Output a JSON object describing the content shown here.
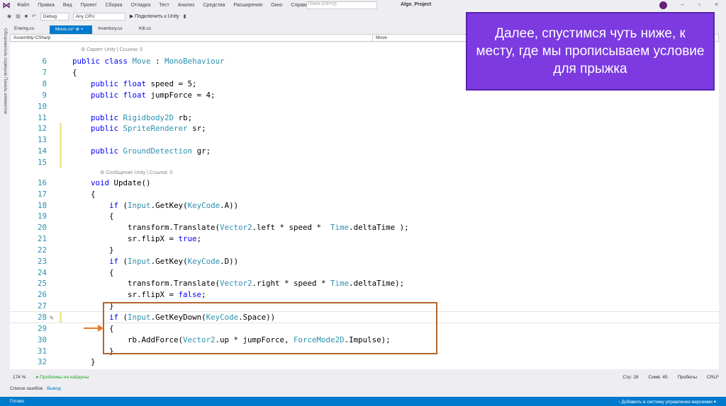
{
  "menu": [
    "Файл",
    "Правка",
    "Вид",
    "Проект",
    "Сборка",
    "Отладка",
    "Тест",
    "Анализ",
    "Средства",
    "Расширения",
    "Окно",
    "Справка"
  ],
  "search_placeholder": "Поиск (Ctrl+Q)",
  "project": "Algo_Project",
  "toolbar": {
    "config": "Debug",
    "platform": "Any CPU",
    "attach": "▶ Подключить к Unity"
  },
  "tabs": [
    {
      "label": "Enemy.cs"
    },
    {
      "label": "Move.cs*  ⊕ ×"
    },
    {
      "label": "Inventory.cs"
    },
    {
      "label": "Kill.cs"
    }
  ],
  "nav": {
    "project": "Assembly-CSharp",
    "class": "Move"
  },
  "side": "Обозреватель серверов   Панель элементов",
  "lens": {
    "class": "⚙ Скрипт Unity | Ссылок: 0",
    "method": "⚙ Сообщение Unity | Ссылок: 0"
  },
  "lines": [
    {
      "n": "6",
      "h": "<span class=kw>public class</span> <span class=ty>Move</span> : <span class=ty>MonoBehaviour</span>"
    },
    {
      "n": "7",
      "h": "{"
    },
    {
      "n": "8",
      "h": "    <span class=kw>public float</span> speed = 5;"
    },
    {
      "n": "9",
      "h": "    <span class=kw>public float</span> jumpForce = 4;"
    },
    {
      "n": "10",
      "h": ""
    },
    {
      "n": "11",
      "h": "    <span class=kw>public</span> <span class=ty>Rigidbody2D</span> rb;"
    },
    {
      "n": "12",
      "h": "    <span class=kw>public</span> <span class=ty>SpriteRenderer</span> sr;",
      "c": 1
    },
    {
      "n": "13",
      "h": "",
      "c": 1
    },
    {
      "n": "14",
      "h": "    <span class=kw>public</span> <span class=ty>GroundDetection</span> gr;",
      "c": 1
    },
    {
      "n": "15",
      "h": "",
      "c": 1
    },
    {
      "n": "16",
      "h": "    <span class=kw>void</span> Update()",
      "lens": 1
    },
    {
      "n": "17",
      "h": "    {"
    },
    {
      "n": "18",
      "h": "        <span class=kw>if</span> (<span class=ty>Input</span>.GetKey(<span class=ty>KeyCode</span>.A))"
    },
    {
      "n": "19",
      "h": "        {"
    },
    {
      "n": "20",
      "h": "            transform.Translate(<span class=ty>Vector2</span>.left * speed *  <span class=ty>Time</span>.deltaTime );"
    },
    {
      "n": "21",
      "h": "            sr.flipX = <span class=kw>true</span>;"
    },
    {
      "n": "22",
      "h": "        }"
    },
    {
      "n": "23",
      "h": "        <span class=kw>if</span> (<span class=ty>Input</span>.GetKey(<span class=ty>KeyCode</span>.D))"
    },
    {
      "n": "24",
      "h": "        {"
    },
    {
      "n": "25",
      "h": "            transform.Translate(<span class=ty>Vector2</span>.right * speed * <span class=ty>Time</span>.deltaTime);"
    },
    {
      "n": "26",
      "h": "            sr.flipX = <span class=kw>false</span>;"
    },
    {
      "n": "27",
      "h": "        }"
    },
    {
      "n": "28",
      "h": "        <span class=kw>if</span> (<span class=ty>Input</span>.GetKeyDown(<span class=ty>KeyCode</span>.Space))",
      "c": 1,
      "cur": 1
    },
    {
      "n": "29",
      "h": "        {"
    },
    {
      "n": "30",
      "h": "            rb.AddForce(<span class=ty>Vector2</span>.up * jumpForce, <span class=ty>ForceMode2D</span>.Impulse);"
    },
    {
      "n": "31",
      "h": "        }"
    },
    {
      "n": "32",
      "h": "    }"
    },
    {
      "n": "33",
      "h": ""
    }
  ],
  "status": {
    "zoom": "174 %",
    "problems": "● Проблемы не найдены",
    "line": "Стр: 28",
    "col": "Симв: 45",
    "spaces": "Пробелы",
    "eol": "CRLF"
  },
  "panel_tabs": [
    "Список ошибок",
    "Вывод"
  ],
  "statusbar": {
    "ready": "Готово",
    "vcs": "↑ Добавить в систему управления версиями ▾"
  },
  "callout": "Далее, спустимся чуть ниже, к месту, где мы прописываем условие для прыжка",
  "colors": {
    "accent": "#007acc",
    "callout": "#7c3ae0",
    "highlight": "#b5652c"
  }
}
